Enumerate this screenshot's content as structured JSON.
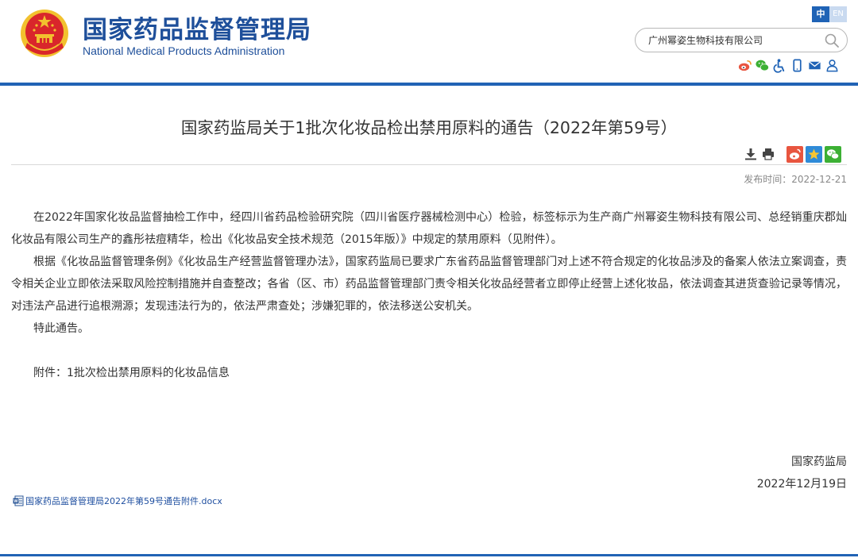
{
  "header": {
    "title_cn": "国家药品监督管理局",
    "title_en": "National Medical Products Administration",
    "lang_cn": "中",
    "lang_en": "EN",
    "search": {
      "value": "广州幂姿生物科技有限公司"
    },
    "tool_icons": [
      "weibo-icon",
      "wechat-icon",
      "accessibility-icon",
      "mobile-icon",
      "mail-icon",
      "user-icon"
    ]
  },
  "article": {
    "title": "国家药监局关于1批次化妆品检出禁用原料的通告（2022年第59号）",
    "publish_label": "发布时间：",
    "publish_date": "2022-12-21",
    "paragraphs": [
      "在2022年国家化妆品监督抽检工作中，经四川省药品检验研究院（四川省医疗器械检测中心）检验，标签标示为生产商广州幂姿生物科技有限公司、总经销重庆郡灿化妆品有限公司生产的鑫彤祛痘精华，检出《化妆品安全技术规范（2015年版）》中规定的禁用原料（见附件）。",
      "根据《化妆品监督管理条例》《化妆品生产经营监督管理办法》，国家药监局已要求广东省药品监督管理部门对上述不符合规定的化妆品涉及的备案人依法立案调查，责令相关企业立即依法采取风险控制措施并自查整改；各省（区、市）药品监督管理部门责令相关化妆品经营者立即停止经营上述化妆品，依法调查其进货查验记录等情况，对违法产品进行追根溯源；发现违法行为的，依法严肃查处；涉嫌犯罪的，依法移送公安机关。",
      "特此通告。"
    ],
    "attachment_line": "附件：1批次检出禁用原料的化妆品信息",
    "signature_org": "国家药监局",
    "signature_date": "2022年12月19日",
    "attachment_file": "国家药品监督管理局2022年第59号通告附件.docx"
  },
  "colors": {
    "brand_blue": "#1e4f9a",
    "bar_blue": "#2163b5",
    "emblem_red": "#d9262b",
    "emblem_gold": "#f2c12e",
    "weibo_bg": "#e8553f",
    "star_bg": "#2f8bd8",
    "wechat_bg": "#3cb034"
  }
}
